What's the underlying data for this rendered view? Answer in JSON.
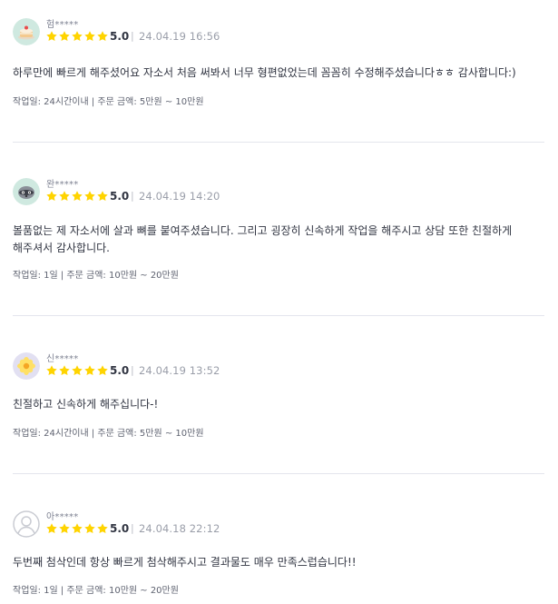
{
  "reviews": [
    {
      "username": "험*****",
      "avatar_icon": "cake-avatar-icon",
      "rating": "5.0",
      "separator": "|",
      "date": "24.04.19 16:56",
      "content": "하루만에 빠르게 해주셨어요 자소서 처음 써봐서 너무 형편없었는데 꼼꼼히 수정해주셨습니다ㅎㅎ 감사합니다:)",
      "meta": "작업일: 24시간이내 | 주문 금액: 5만원 ~ 10만원"
    },
    {
      "username": "완*****",
      "avatar_icon": "raccoon-avatar-icon",
      "rating": "5.0",
      "separator": "|",
      "date": "24.04.19 14:20",
      "content": "볼품없는 제 자소서에 살과 뼈를 붙여주셨습니다. 그리고 굉장히 신속하게 작업을 해주시고 상담 또한 친절하게 해주셔서 감사합니다.",
      "meta": "작업일: 1일 | 주문 금액: 10만원 ~ 20만원"
    },
    {
      "username": "신*****",
      "avatar_icon": "flower-avatar-icon",
      "rating": "5.0",
      "separator": "|",
      "date": "24.04.19 13:52",
      "content": "친절하고 신속하게 해주십니다-!",
      "meta": "작업일: 24시간이내 | 주문 금액: 5만원 ~ 10만원"
    },
    {
      "username": "아*****",
      "avatar_icon": "default-user-avatar-icon",
      "rating": "5.0",
      "separator": "|",
      "date": "24.04.18 22:12",
      "content": "두번째 첨삭인데 항상 빠르게 첨삭해주시고 결과물도 매우 만족스럽습니다!!",
      "meta": "작업일: 1일 | 주문 금액: 10만원 ~ 20만원"
    }
  ],
  "colors": {
    "star": "#ffd400",
    "text": "#303441",
    "muted": "#9a9ea9",
    "divider": "#e4e5ed"
  }
}
